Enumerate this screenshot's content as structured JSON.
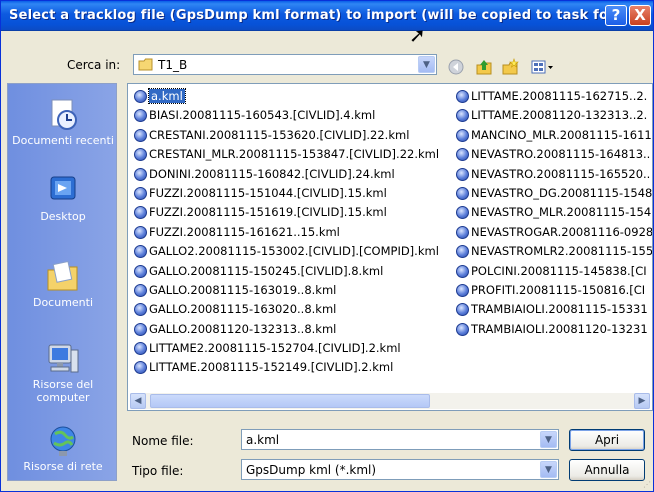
{
  "window": {
    "title": "Select a tracklog file (GpsDump kml format) to import (will be copied to task fo...",
    "help_glyph": "?",
    "close_glyph": "X"
  },
  "toolbar": {
    "look_in_label": "Cerca in:",
    "look_in_value": "T1_B",
    "icons": [
      "back-icon",
      "up-folder-icon",
      "new-folder-icon",
      "view-menu-icon"
    ]
  },
  "places": [
    {
      "label": "Documenti recenti",
      "icon": "recent-documents-icon"
    },
    {
      "label": "Desktop",
      "icon": "desktop-icon"
    },
    {
      "label": "Documenti",
      "icon": "my-documents-icon"
    },
    {
      "label": "Risorse del computer",
      "icon": "my-computer-icon"
    },
    {
      "label": "Risorse di rete",
      "icon": "network-places-icon"
    }
  ],
  "files": {
    "column1": [
      "a.kml",
      "BIASI.20081115-160543.[CIVLID].4.kml",
      "CRESTANI.20081115-153620.[CIVLID].22.kml",
      "CRESTANI_MLR.20081115-153847.[CIVLID].22.kml",
      "DONINI.20081115-160842.[CIVLID].24.kml",
      "FUZZI.20081115-151044.[CIVLID].15.kml",
      "FUZZI.20081115-151619.[CIVLID].15.kml",
      "FUZZI.20081115-161621..15.kml",
      "GALLO2.20081115-153002.[CIVLID].[COMPID].kml",
      "GALLO.20081115-150245.[CIVLID].8.kml",
      "GALLO.20081115-163019..8.kml",
      "GALLO.20081115-163020..8.kml",
      "GALLO.20081120-132313..8.kml",
      "LITTAME2.20081115-152704.[CIVLID].2.kml",
      "LITTAME.20081115-152149.[CIVLID].2.kml"
    ],
    "column2": [
      "LITTAME.20081115-162715..2.",
      "LITTAME.20081120-132313..2.",
      "MANCINO_MLR.20081115-1611",
      "NEVASTRO.20081115-164813..",
      "NEVASTRO.20081115-165520..",
      "NEVASTRO_DG.20081115-1548",
      "NEVASTRO_MLR.20081115-154",
      "NEVASTROGAR.20081116-0928",
      "NEVASTROMLR2.20081115-155",
      "POLCINI.20081115-145838.[CI",
      "PROFITI.20081115-150816.[CI",
      "TRAMBIAIOLI.20081115-15331",
      "TRAMBIAIOLI.20081120-13231"
    ],
    "selected": "a.kml"
  },
  "form": {
    "filename_label": "Nome file:",
    "filename_value": "a.kml",
    "filetype_label": "Tipo file:",
    "filetype_value": "GpsDump kml (*.kml)"
  },
  "buttons": {
    "open_label": "Apri",
    "cancel_label": "Annulla"
  },
  "colors": {
    "titlebar": "#0a5ee8",
    "selection": "#316ac5",
    "places_bar": "#7f9be3"
  }
}
